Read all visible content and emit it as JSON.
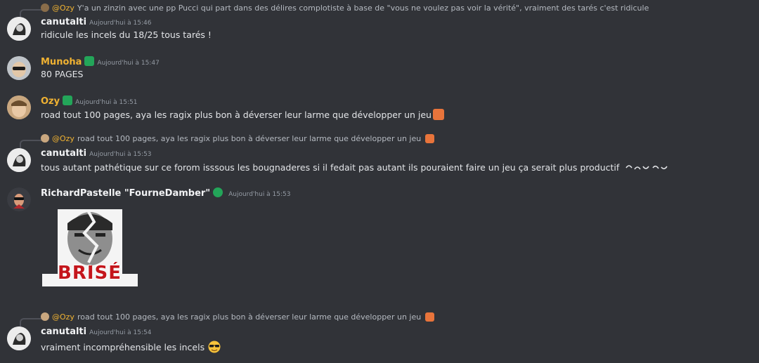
{
  "messages": [
    {
      "reply": {
        "mention": "@Ozy",
        "text": "Y'a un zinzin avec une pp Pucci qui part dans des délires complotiste à base de \"vous ne voulez pas voir la vérité\", vraiment des tarés c'est ridicule"
      },
      "author": "canutalti",
      "timestamp": "Aujourd'hui à 15:46",
      "content": "ridicule les incels du 18/25 tous tarés !"
    },
    {
      "author": "Munoha",
      "author_color": "#f0b232",
      "timestamp": "Aujourd'hui à 15:47",
      "content": "80 PAGES"
    },
    {
      "author": "Ozy",
      "author_color": "#f0b232",
      "timestamp": "Aujourd'hui à 15:51",
      "content": "road tout 100 pages, aya les ragix plus bon à déverser leur larme que développer un jeu"
    },
    {
      "reply": {
        "mention": "@Ozy",
        "text": "road tout 100 pages, aya les ragix plus bon à déverser leur larme que développer un jeu"
      },
      "author": "canutalti",
      "timestamp": "Aujourd'hui à 15:53",
      "content": "tous autant pathétique sur ce forom isssous les bougnaderes si il fedait pas autant ils pouraient faire un jeu ça serait plus productif"
    },
    {
      "author": "RichardPastelle \"FourneDamber\"",
      "timestamp": "Aujourd'hui à 15:53",
      "image_caption": "BRISÉ"
    },
    {
      "reply": {
        "mention": "@Ozy",
        "text": "road tout 100 pages, aya les ragix plus bon à déverser leur larme que développer un jeu"
      },
      "author": "canutalti",
      "timestamp": "Aujourd'hui à 15:54",
      "content": "vraiment incompréhensible les incels"
    }
  ],
  "icons": [
    "reply-avatar-icon",
    "server-badge-icon",
    "nitro-badge-icon",
    "fire-emoji-icon",
    "sunglasses-emoji-icon"
  ],
  "colors": {
    "background": "#313338",
    "mention": "#f0b232",
    "badge_green": "#23a559"
  }
}
